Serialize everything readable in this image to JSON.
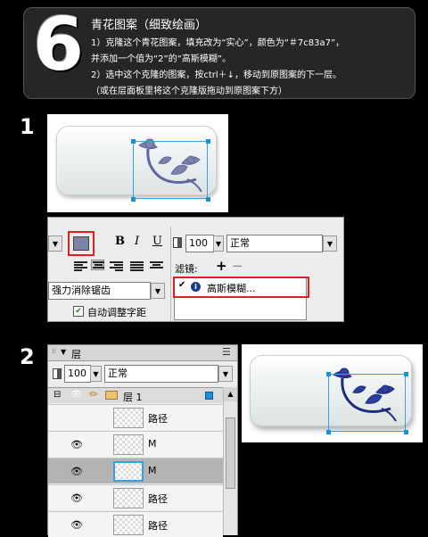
{
  "header": {
    "number": "6",
    "title": "青花图案（细致绘画）",
    "lines": [
      "1）克隆这个青花图案，填充改为“实心”，颜色为“＃7c83a7”，",
      "并添加一个值为“2”的“高斯模糊”。",
      "2）选中这个克隆的图案，按ctrl＋↓，移动到原图案的下一层。",
      "（或在层面板里将这个克隆版拖动到原图案下方）"
    ]
  },
  "steps": {
    "one": "1",
    "two": "2"
  },
  "colors": {
    "fill_swatch": "#7c83a7",
    "accent_red": "#e02020",
    "selection": "#1a8fd8"
  },
  "props_panel": {
    "font_size": "100",
    "blend_mode": "正常",
    "filter_label": "滤镜:",
    "add_icon": "+",
    "remove_icon": "−",
    "filter_item": "高斯模糊...",
    "antialias": "强力消除锯齿",
    "auto_kern": "自动调整字距",
    "bold": "B",
    "italic": "I",
    "underline": "U"
  },
  "layers_panel": {
    "title": "层",
    "opacity": "100",
    "blend_mode": "正常",
    "layer_name": "层 1",
    "rows": [
      {
        "name": "路径",
        "eye": false,
        "selected": false
      },
      {
        "name": "M",
        "eye": true,
        "selected": false
      },
      {
        "name": "M",
        "eye": true,
        "selected": true
      },
      {
        "name": "路径",
        "eye": true,
        "selected": false
      },
      {
        "name": "路径",
        "eye": true,
        "selected": false
      }
    ]
  }
}
